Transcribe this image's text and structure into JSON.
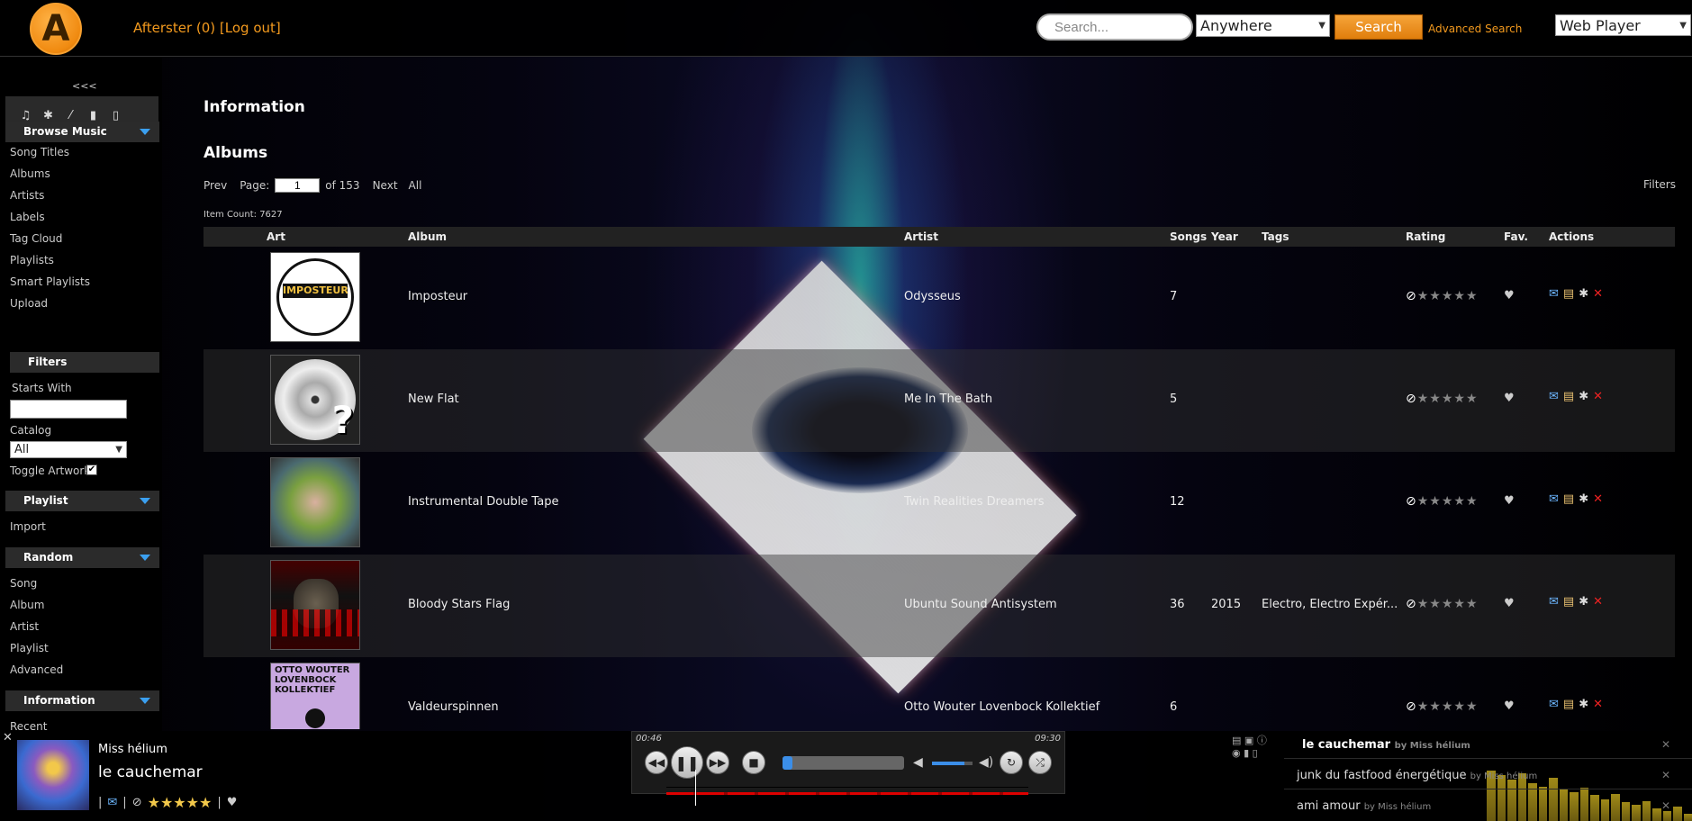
{
  "header": {
    "logo_letter": "A",
    "username": "Afterster (0)",
    "logout": "[Log out]",
    "search_placeholder": "Search...",
    "scope": "Anywhere",
    "search_button": "Search",
    "advanced_search": "Advanced Search",
    "player_mode": "Web Player"
  },
  "sidebar": {
    "collapse": "<<<",
    "browse_header": "Browse Music",
    "browse_items": [
      "Song Titles",
      "Albums",
      "Artists",
      "Labels",
      "Tag Cloud",
      "Playlists",
      "Smart Playlists",
      "Upload"
    ],
    "filters_header": "Filters",
    "starts_with_label": "Starts With",
    "catalog_label": "Catalog",
    "catalog_value": "All",
    "toggle_artwork_label": "Toggle Artwork",
    "playlist_header": "Playlist",
    "playlist_items": [
      "Import"
    ],
    "random_header": "Random",
    "random_items": [
      "Song",
      "Album",
      "Artist",
      "Playlist",
      "Advanced"
    ],
    "information_header": "Information",
    "information_items": [
      "Recent"
    ]
  },
  "main": {
    "info_title": "Information",
    "albums_title": "Albums",
    "pager": {
      "prev": "Prev",
      "page_label": "Page:",
      "page_value": "1",
      "of_text": "of 153",
      "next": "Next",
      "all": "All"
    },
    "filters_link": "Filters",
    "item_count": "Item Count: 7627",
    "columns": {
      "art": "Art",
      "album": "Album",
      "artist": "Artist",
      "songs": "Songs",
      "year": "Year",
      "tags": "Tags",
      "rating": "Rating",
      "fav": "Fav.",
      "actions": "Actions"
    },
    "rows": [
      {
        "album": "Imposteur",
        "artist": "Odysseus",
        "songs": "7",
        "year": "",
        "tags": "",
        "art_text": "IMPOSTEUR"
      },
      {
        "album": "New Flat",
        "artist": "Me In The Bath",
        "songs": "5",
        "year": "",
        "tags": ""
      },
      {
        "album": "Instrumental Double Tape",
        "artist": "Twin Realities Dreamers",
        "songs": "12",
        "year": "",
        "tags": ""
      },
      {
        "album": "Bloody Stars Flag",
        "artist": "Ubuntu Sound Antisystem",
        "songs": "36",
        "year": "2015",
        "tags": "Electro, Electro Expér..."
      },
      {
        "album": "Valdeurspinnen",
        "artist": "Otto Wouter Lovenbock Kollektief",
        "songs": "6",
        "year": "",
        "tags": "",
        "art_text": "OTTO WOUTER LOVENBOCK KOLLEKTIEF"
      }
    ]
  },
  "player": {
    "close": "✕",
    "now_artist": "Miss hélium",
    "now_title": "le cauchemar",
    "rating_stars": 5,
    "elapsed": "00:46",
    "total": "09:30",
    "progress": 0.08,
    "volume": 0.8,
    "playlist": [
      {
        "title": "le cauchemar",
        "by": "by Miss hélium",
        "active": true
      },
      {
        "title": "junk du fastfood énergétique",
        "by": "by Miss hélium",
        "active": false
      },
      {
        "title": "ami amour",
        "by": "by Miss hélium",
        "active": false
      }
    ]
  },
  "colors": {
    "accent": "#f39a1e",
    "header_bg": "#000000",
    "row_alt": "#323232",
    "delete_red": "#e22222",
    "comment_blue": "#6cb6ff"
  },
  "icons": {
    "sidebar_toolbar": [
      "headphones-icon",
      "gear-icon",
      "wand-icon",
      "mobile-icon",
      "door-icon"
    ],
    "row_actions": [
      "comment-icon",
      "edit-icon",
      "gear-icon",
      "delete-icon"
    ]
  }
}
